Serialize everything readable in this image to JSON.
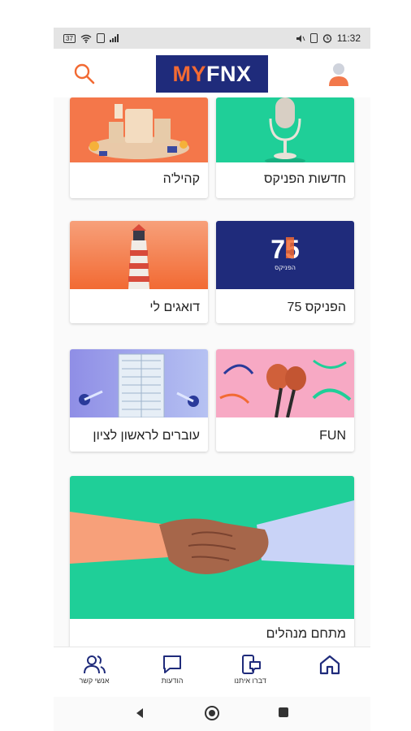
{
  "statusbar": {
    "left_badge": "37",
    "time": "11:32"
  },
  "app": {
    "logo_my": "MY",
    "logo_fnx": "FNX"
  },
  "cards": [
    {
      "label": "חדשות הפניקס",
      "image": "podcast-microphone"
    },
    {
      "label": "קהיל'ה",
      "image": "community-3d-cityscape"
    },
    {
      "label": "הפניקס 75",
      "image": "phoenix-75-logo",
      "logo_number": "75",
      "logo_text": "הפניקס"
    },
    {
      "label": "דואגים לי",
      "image": "lighthouse"
    },
    {
      "label": "FUN",
      "image": "maracas-confetti"
    },
    {
      "label": "עוברים לראשון לציון",
      "image": "office-building"
    },
    {
      "label": "מתחם מנהלים",
      "image": "handshake"
    }
  ],
  "bottom_nav": [
    {
      "label": "דף הבית",
      "icon": "home-icon",
      "active": true
    },
    {
      "label": "דברו איתנו",
      "icon": "phone-chat-icon"
    },
    {
      "label": "הודעות",
      "icon": "message-icon"
    },
    {
      "label": "אנשי קשר",
      "icon": "contacts-icon"
    }
  ],
  "colors": {
    "brand_navy": "#1f2b7b",
    "brand_orange": "#f26a33",
    "green": "#1fcf98",
    "active_nav": "#1f2b7b"
  }
}
